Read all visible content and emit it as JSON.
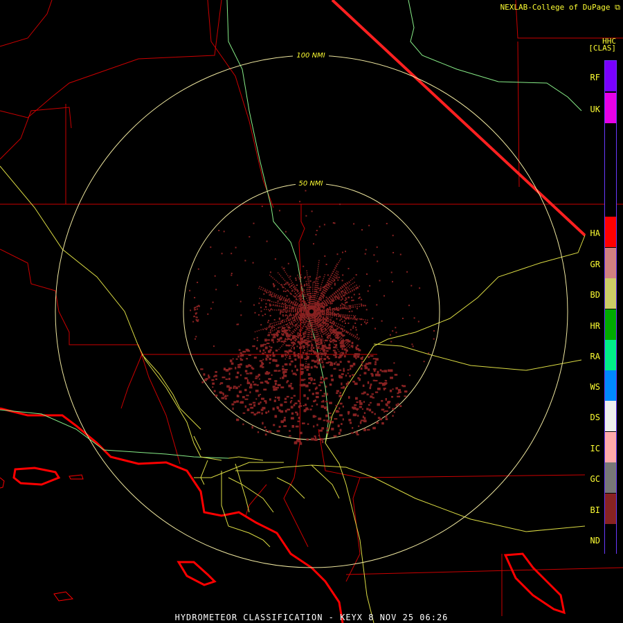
{
  "header": {
    "credit": "NEXLAB-College of DuPage",
    "credit_icon": "external-link-icon",
    "product": "HHC",
    "class_code": "[CLAS]"
  },
  "rings": [
    {
      "label": "100 NMI"
    },
    {
      "label": "50 NMI"
    }
  ],
  "legend": [
    {
      "code": "RF",
      "color": "#7a00ff"
    },
    {
      "code": "UK",
      "color": "#e800e8"
    },
    {
      "code": "HA",
      "color": "#ff0000"
    },
    {
      "code": "GR",
      "color": "#d08080"
    },
    {
      "code": "BD",
      "color": "#cccc66"
    },
    {
      "code": "HR",
      "color": "#00aa00"
    },
    {
      "code": "RA",
      "color": "#00ee88"
    },
    {
      "code": "WS",
      "color": "#0088ff"
    },
    {
      "code": "DS",
      "color": "#eeeeee"
    },
    {
      "code": "IC",
      "color": "#ffaaaa"
    },
    {
      "code": "GC",
      "color": "#777777"
    },
    {
      "code": "BI",
      "color": "#882222"
    },
    {
      "code": "ND",
      "color": "#000000"
    }
  ],
  "colors": {
    "county": "#cc0000",
    "coast": "#ff0000",
    "highway": "#dddd44",
    "river": "#88ee88",
    "ring": "#f0e8a0",
    "echo": "#882222"
  },
  "footer": "HYDROMETEOR CLASSIFICATION - KEYX 8 NOV 25 06:26"
}
